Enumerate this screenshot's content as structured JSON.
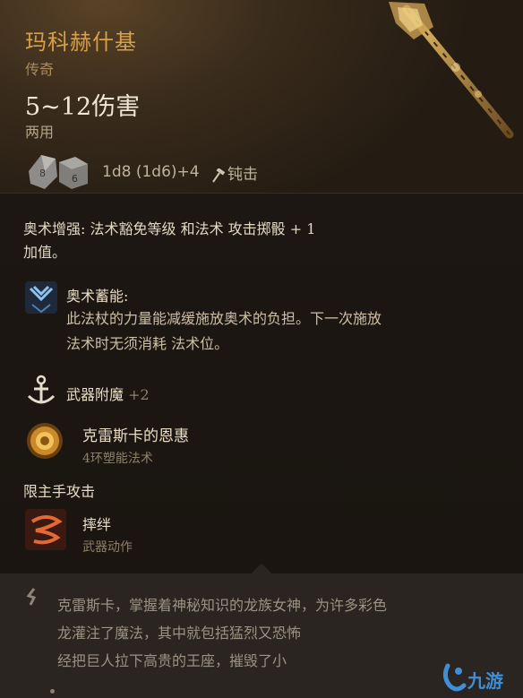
{
  "item": {
    "name": "玛科赫什基",
    "rarity": "传奇",
    "damage": "5~12伤害",
    "handedness": "两用",
    "dice_formula": "1d8 (1d6)+4",
    "damage_type": "钝击",
    "dice_icons": [
      "d8-die-icon",
      "d6-die-icon"
    ],
    "damage_type_icon": "hammer-icon"
  },
  "enchant": {
    "line1": "奥术增强: 法术豁免等级 和法术 攻击掷骰 + 1",
    "line2": "加值。"
  },
  "features": {
    "arcane_reserve": {
      "title": "奥术蓄能:",
      "desc_line1": "此法杖的力量能减缓施放奥术的负担。下一次施放",
      "desc_line2": "法术时无须消耗 法术位。",
      "icon": "arcane-reserve-icon"
    },
    "weapon_enchant": {
      "title": "武器附魔",
      "bonus": "+2",
      "icon": "anchor-icon"
    },
    "grace": {
      "title": "克雷斯卡的恩惠",
      "subtitle": "4环塑能法术",
      "icon": "golden-seal-icon"
    },
    "section_label": "限主手攻击",
    "weapon_action": {
      "title": "摔绊",
      "subtitle": "武器动作",
      "icon": "topple-icon"
    }
  },
  "lore": {
    "line1": "克雷斯卡，掌握着神秘知识的龙族女神，为许多彩色",
    "line2": "龙灌注了魔法，其中就包括猛烈又恐怖",
    "line3": "经把巨人拉下高贵的王座，摧毁了小"
  },
  "watermark": {
    "text": "九游"
  },
  "colors": {
    "title_gold": "#d6a14a",
    "panel_bg": "#1c1712",
    "footer_bg": "#2a2520",
    "watermark_blue": "#3f8ed6"
  }
}
